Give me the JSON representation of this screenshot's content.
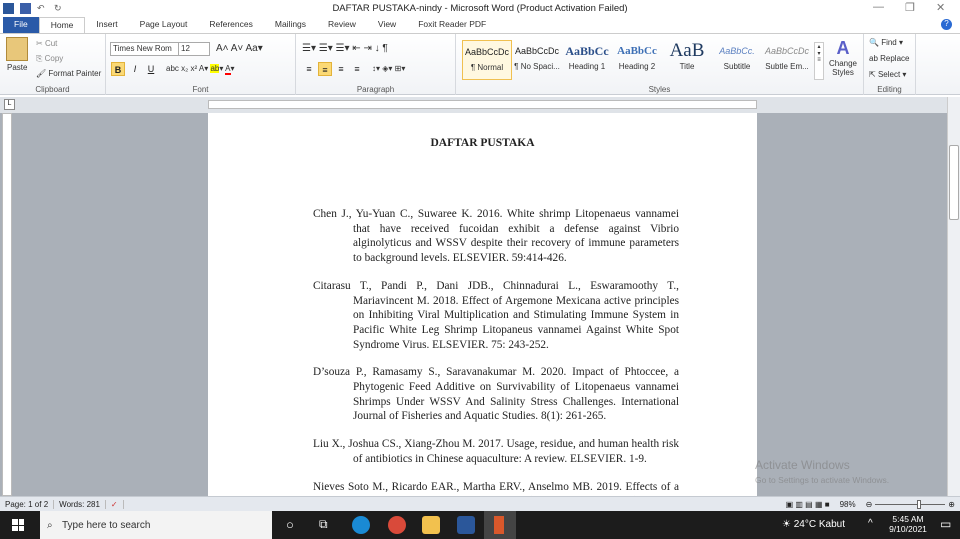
{
  "window": {
    "title": "DAFTAR PUSTAKA-nindy  -  Microsoft Word (Product Activation Failed)"
  },
  "tabs": [
    "File",
    "Home",
    "Insert",
    "Page Layout",
    "References",
    "Mailings",
    "Review",
    "View",
    "Foxit Reader PDF"
  ],
  "clipboard": {
    "paste": "Paste",
    "cut": "Cut",
    "copy": "Copy",
    "format_painter": "Format Painter",
    "label": "Clipboard"
  },
  "font": {
    "name": "Times New Rom",
    "size": "12",
    "label": "Font",
    "bold": "B",
    "italic": "I",
    "underline": "U"
  },
  "paragraph": {
    "label": "Paragraph"
  },
  "styles": {
    "label": "Styles",
    "items": [
      {
        "sample": "AaBbCcDc",
        "name": "¶ Normal"
      },
      {
        "sample": "AaBbCcDc",
        "name": "¶ No Spaci..."
      },
      {
        "sample": "AaBbCc",
        "name": "Heading 1"
      },
      {
        "sample": "AaBbCc",
        "name": "Heading 2"
      },
      {
        "sample": "AaB",
        "name": "Title"
      },
      {
        "sample": "AaBbCc.",
        "name": "Subtitle"
      },
      {
        "sample": "AaBbCcDc",
        "name": "Subtle Em..."
      }
    ],
    "change": "Change Styles"
  },
  "editing": {
    "label": "Editing",
    "find": "Find",
    "replace": "Replace",
    "select": "Select"
  },
  "document": {
    "heading": "DAFTAR PUSTAKA",
    "references": [
      "Chen J., Yu-Yuan C., Suwaree K. 2016. White shrimp Litopenaeus vannamei that have received fucoidan exhibit a defense against Vibrio alginolyticus and WSSV despite their recovery of immune parameters to background levels. ELSEVIER. 59:414-426.",
      "Citarasu T., Pandi P., Dani JDB., Chinnadurai L., Eswaramoothy T., Mariavincent M. 2018. Effect of Argemone Mexicana active principles on Inhibiting Viral Multiplication and Stimulating Immune System in Pacific White Leg Shrimp Litopaneus vannamei Against White Spot Syndrome Virus. ELSEVIER. 75: 243-252.",
      "D’souza P., Ramasamy S., Saravanakumar M. 2020. Impact of Phtoccee, a Phytogenic Feed Additive on Survivability of Litopenaeus vannamei Shrimps Under WSSV And Salinity Stress Challenges. International Journal of Fisheries and Aquatic Studies. 8(1): 261-265.",
      "Liu X., Joshua CS., Xiang-Zhou M. 2017. Usage, residue, and human health risk of antibiotics in Chinese aquaculture: A review. ELSEVIER. 1-9.",
      "Nieves Soto M., Ricardo EAR., Martha ERV., Anselmo MB. 2019. Effects of a co-culture of marine algae and shrimp (Litopenaeus vannamei) on the"
    ]
  },
  "status": {
    "page": "Page: 1 of 2",
    "words": "Words: 281",
    "zoom": "98%"
  },
  "watermark": {
    "line1": "Activate Windows",
    "line2": "Go to Settings to activate Windows."
  },
  "taskbar": {
    "search_placeholder": "Type here to search",
    "weather": "24°C  Kabut",
    "time": "5:45 AM",
    "date": "9/10/2021"
  }
}
